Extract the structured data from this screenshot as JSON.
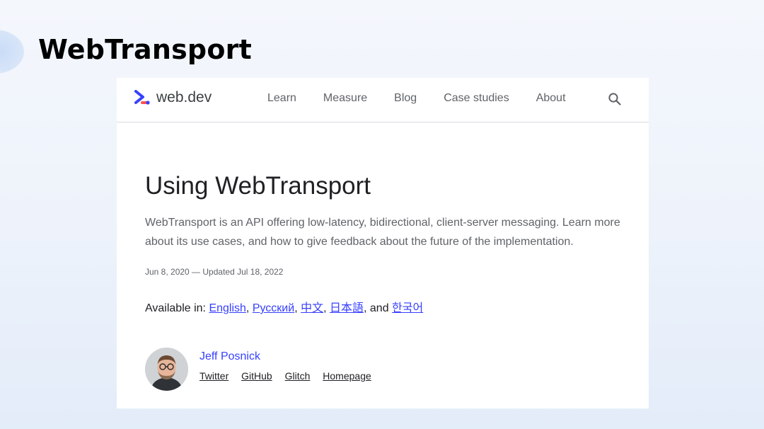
{
  "slide": {
    "title": "WebTransport"
  },
  "site": {
    "brand": "web.dev",
    "nav": [
      "Learn",
      "Measure",
      "Blog",
      "Case studies",
      "About"
    ],
    "search_icon": "search-icon"
  },
  "article": {
    "title": "Using WebTransport",
    "summary": "WebTransport is an API offering low-latency, bidirectional, client-server messaging. Learn more about its use cases, and how to give feedback about the future of the implementation.",
    "dates": "Jun 8, 2020 — Updated Jul 18, 2022",
    "available_prefix": "Available in: ",
    "languages": [
      "English",
      "Русский",
      "中文",
      "日本語",
      "한국어"
    ],
    "sep_comma": ", ",
    "sep_and": ", and "
  },
  "author": {
    "name": "Jeff Posnick",
    "links": [
      "Twitter",
      "GitHub",
      "Glitch",
      "Homepage"
    ]
  },
  "colors": {
    "accent": "#3740ff",
    "text": "#202124",
    "muted": "#5f6368"
  }
}
